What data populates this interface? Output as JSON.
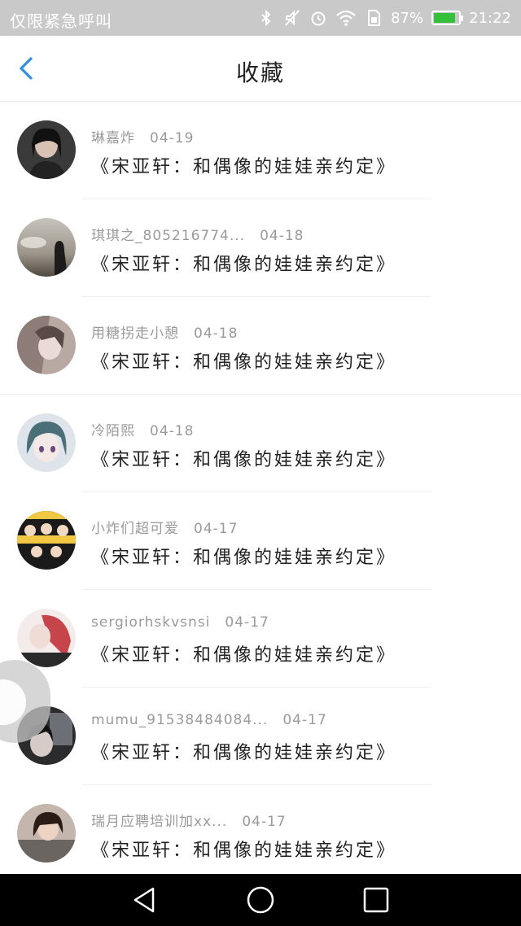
{
  "status_bar": {
    "carrier": "仅限紧急呼叫",
    "battery": "87%",
    "time": "21:22",
    "battery_fill": 0.87,
    "icons": [
      "bluetooth-icon",
      "mute-icon",
      "alarm-icon",
      "wifi-icon",
      "sim-icon",
      "battery-icon"
    ]
  },
  "header": {
    "title": "收藏",
    "back_icon": "back-chevron-icon",
    "accent": "#2f8ee8"
  },
  "items": [
    {
      "user": "琳嘉炸",
      "date": "04-19",
      "title": "《宋亚轩：和偶像的娃娃亲约定》"
    },
    {
      "user": "琪琪之_805216774...",
      "date": "04-18",
      "title": "《宋亚轩：和偶像的娃娃亲约定》"
    },
    {
      "user": "用糖拐走小憩",
      "date": "04-18",
      "title": "《宋亚轩：和偶像的娃娃亲约定》"
    },
    {
      "user": "冷陌熙",
      "date": "04-18",
      "title": "《宋亚轩：和偶像的娃娃亲约定》"
    },
    {
      "user": "小炸们超可爱",
      "date": "04-17",
      "title": "《宋亚轩：和偶像的娃娃亲约定》"
    },
    {
      "user": "sergiorhskvsnsi",
      "date": "04-17",
      "title": "《宋亚轩：和偶像的娃娃亲约定》"
    },
    {
      "user": "mumu_91538484084...",
      "date": "04-17",
      "title": "《宋亚轩：和偶像的娃娃亲约定》"
    },
    {
      "user": "瑞月应聘培训加xx...",
      "date": "04-17",
      "title": "《宋亚轩：和偶像的娃娃亲约定》"
    }
  ],
  "nav": {
    "icons": [
      "back-triangle-icon",
      "home-circle-icon",
      "recents-square-icon"
    ]
  }
}
